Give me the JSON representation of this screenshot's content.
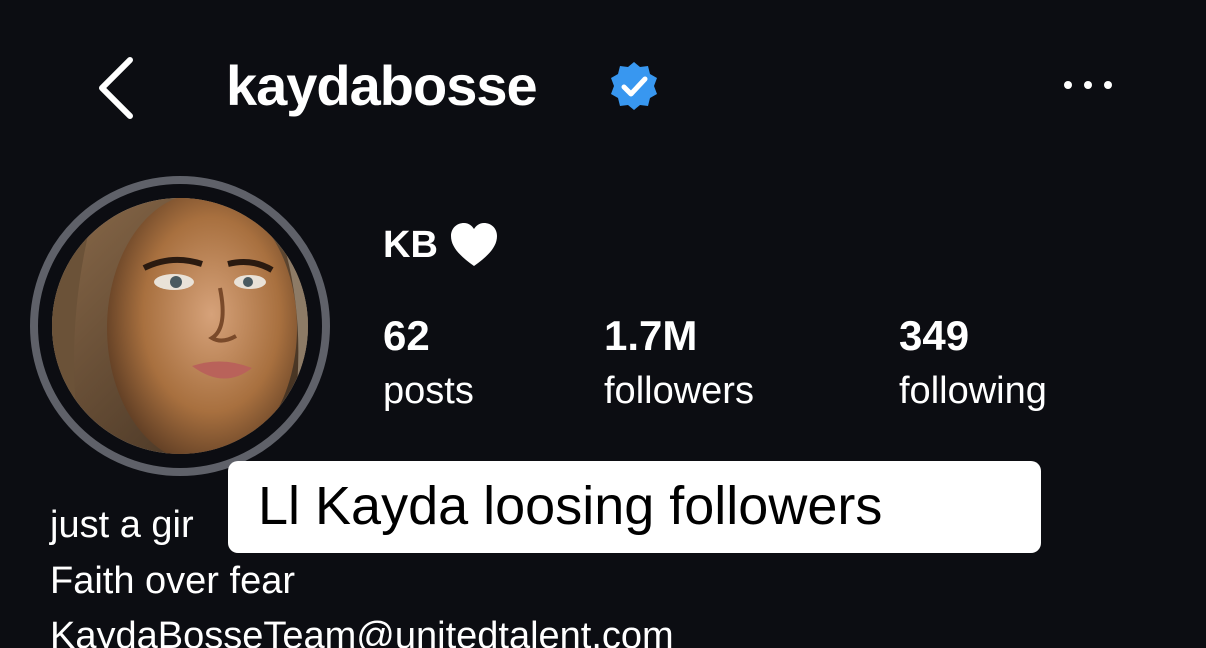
{
  "header": {
    "back_icon": "chevron-left-icon",
    "username": "kaydabosse",
    "verified_icon": "verified-badge-icon",
    "more_icon": "more-horizontal-icon"
  },
  "profile": {
    "display_name": "KB",
    "name_emoji_icon": "white-heart-icon",
    "stats": [
      {
        "value": "62",
        "label": "posts"
      },
      {
        "value": "1.7M",
        "label": "followers"
      },
      {
        "value": "349",
        "label": "following"
      }
    ],
    "bio": [
      "just a gir",
      "Faith over fear",
      "KaydaBosseTeam@unitedtalent.com"
    ]
  },
  "overlay_caption": "Ll Kayda loosing followers",
  "colors": {
    "background": "#0c0d12",
    "text": "#ffffff",
    "verified_blue": "#3897f0",
    "avatar_ring": "#5f6169",
    "caption_bg": "#ffffff",
    "caption_text": "#000000"
  }
}
